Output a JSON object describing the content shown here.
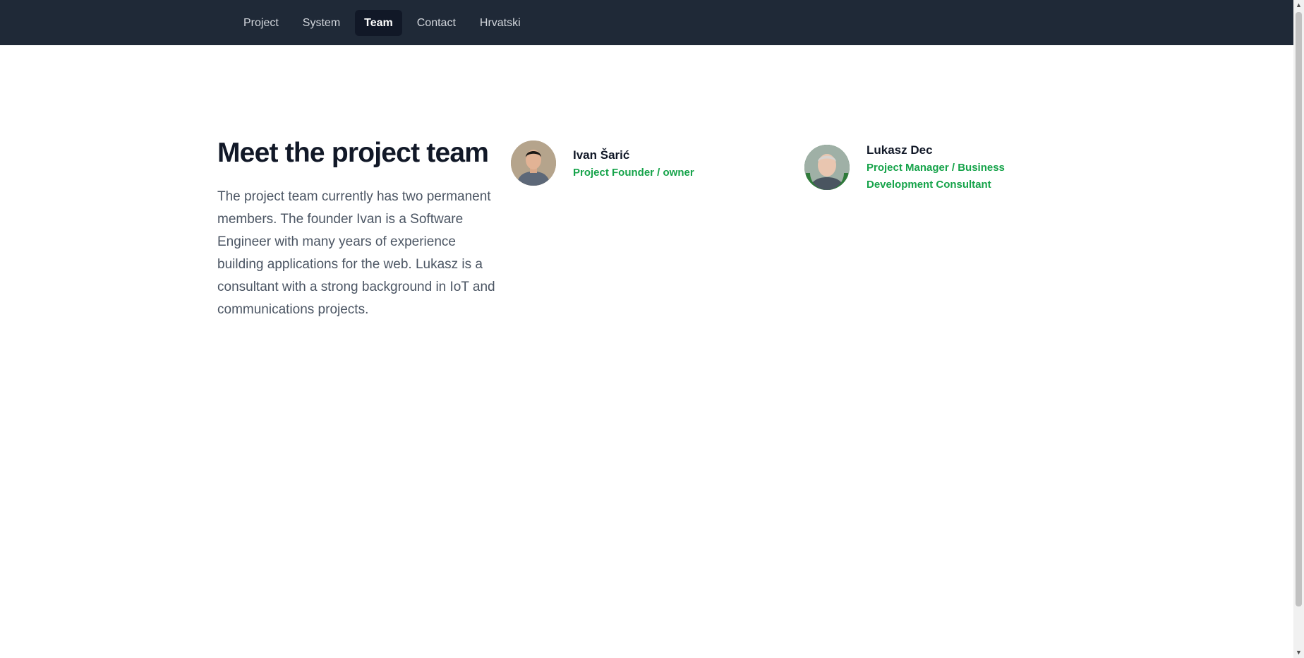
{
  "nav": {
    "items": [
      {
        "label": "Project",
        "active": false
      },
      {
        "label": "System",
        "active": false
      },
      {
        "label": "Team",
        "active": true
      },
      {
        "label": "Contact",
        "active": false
      },
      {
        "label": "Hrvatski",
        "active": false
      }
    ]
  },
  "team": {
    "heading": "Meet the project team",
    "intro": "The project team currently has two permanent members. The founder Ivan is a Software Engineer with many years of experience building applications for the web. Lukasz is a consultant with a strong background in IoT and communications projects.",
    "members": [
      {
        "name": "Ivan Šarić",
        "role": "Project Founder / owner",
        "avatar": "avatar-photo"
      },
      {
        "name": "Lukasz Dec",
        "role": "Project Manager / Business Development Consultant",
        "avatar": "avatar-photo-opentowork"
      }
    ]
  },
  "colors": {
    "nav_background": "#1f2937",
    "nav_active": "#111827",
    "role_accent": "#16a34a"
  }
}
